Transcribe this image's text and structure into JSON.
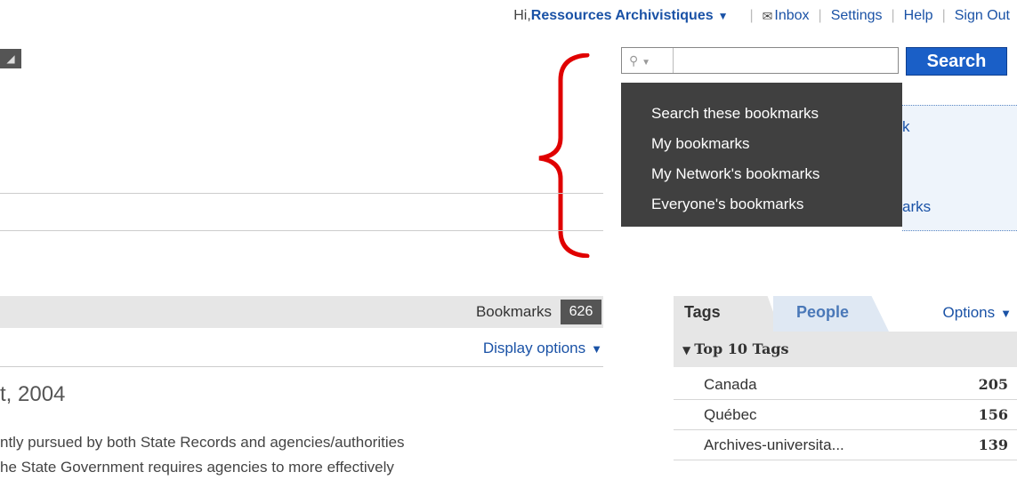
{
  "topnav": {
    "greeting": "Hi, ",
    "username": "Ressources Archivistiques",
    "inbox": "Inbox",
    "settings": "Settings",
    "help": "Help",
    "signout": "Sign Out"
  },
  "search": {
    "value": "",
    "button_label": "Search"
  },
  "search_scope_menu": {
    "items": [
      "Search these bookmarks",
      "My bookmarks",
      "My Network's bookmarks",
      "Everyone's bookmarks"
    ]
  },
  "side_panel": {
    "link_fragment_1": "k",
    "link_fragment_2": "arks"
  },
  "bookmarks": {
    "label": "Bookmarks",
    "count": "626",
    "display_options": "Display options"
  },
  "bookmark_item": {
    "title_fragment": "t, 2004",
    "desc_line_1": "ntly pursued by both State Records and agencies/authorities",
    "desc_line_2": "he State Government requires agencies to more effectively"
  },
  "tags_panel": {
    "tab_tags": "Tags",
    "tab_people": "People",
    "options": "Options",
    "top_tags_header": "Top 10 Tags",
    "tags": [
      {
        "name": "Canada",
        "count": "205"
      },
      {
        "name": "Québec",
        "count": "156"
      },
      {
        "name": "Archives-universita...",
        "count": "139"
      }
    ]
  },
  "colors": {
    "link": "#1a52a6",
    "search_button": "#1a5fc7",
    "dropdown_bg": "#404040",
    "annotation_bracket": "#e00000"
  }
}
